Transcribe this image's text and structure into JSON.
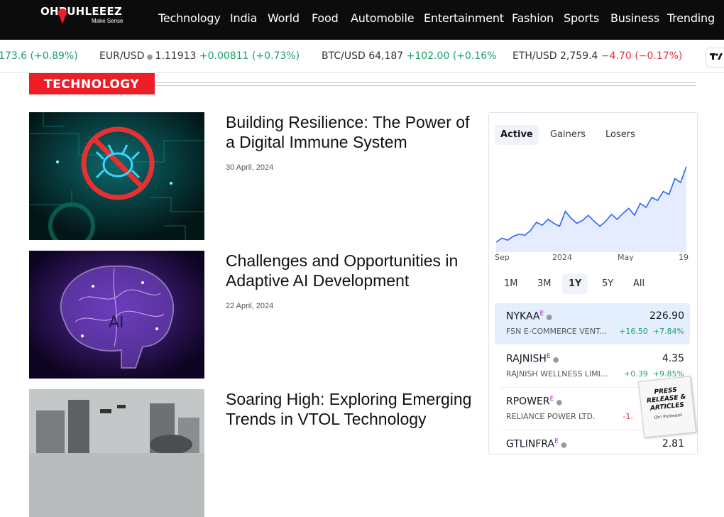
{
  "header": {
    "logo_text": "OHPUHLEEEZ",
    "logo_tagline": "Make Sense",
    "nav": [
      "Technology",
      "India",
      "World",
      "Food",
      "Automobile",
      "Entertainment",
      "Fashion",
      "Sports",
      "Business",
      "Trending"
    ]
  },
  "ticker": [
    {
      "symbol": "",
      "price": "",
      "change": "173.6",
      "pct": "(+0.89%)",
      "dir": "up"
    },
    {
      "symbol": "EUR/USD",
      "price": "1.11913",
      "change": "+0.00811",
      "pct": "(+0.73%)",
      "dir": "up"
    },
    {
      "symbol": "BTC/USD",
      "price": "64,187",
      "change": "+102.00",
      "pct": "(+0.16%",
      "dir": "up"
    },
    {
      "symbol": "ETH/USD",
      "price": "2,759.4",
      "change": "−4.70",
      "pct": "(−0.17%)",
      "dir": "down"
    }
  ],
  "section_title": "TECHNOLOGY",
  "articles": [
    {
      "title": "Building Resilience: The Power of a Digital Immune System",
      "date": "30 April, 2024"
    },
    {
      "title": "Challenges and Opportunities in Adaptive AI Development",
      "date": "22 April, 2024"
    },
    {
      "title": "Soaring High: Exploring Emerging Trends in VTOL Technology",
      "date": ""
    }
  ],
  "widget": {
    "tabs": [
      "Active",
      "Gainers",
      "Losers"
    ],
    "active_tab": "Active",
    "x_labels": [
      "Sep",
      "2024",
      "May",
      "19"
    ],
    "ranges": [
      "1M",
      "3M",
      "1Y",
      "5Y",
      "All"
    ],
    "active_range": "1Y",
    "rows": [
      {
        "symbol": "NYKAA",
        "name": "FSN E-COMMERCE VENT...",
        "price": "226.90",
        "change": "+16.50",
        "pct": "+7.84%",
        "dir": "up"
      },
      {
        "symbol": "RAJNISH",
        "name": "RAJNISH WELLNESS LIMI...",
        "price": "4.35",
        "change": "+0.39",
        "pct": "+9.85%",
        "dir": "up"
      },
      {
        "symbol": "RPOWER",
        "name": "RELIANCE POWER LTD.",
        "price": "",
        "change": "-1.",
        "pct": "",
        "dir": "down"
      },
      {
        "symbol": "GTLINFRA",
        "name": "",
        "price": "2.81",
        "change": "",
        "pct": "",
        "dir": "up"
      }
    ],
    "row_flag": "E",
    "chart_data": {
      "type": "area",
      "title": "",
      "x_ticks": [
        "Sep",
        "2024",
        "May",
        "19"
      ],
      "series": [
        {
          "values": [
            10,
            14,
            12,
            16,
            18,
            17,
            22,
            30,
            27,
            33,
            29,
            26,
            41,
            34,
            29,
            32,
            37,
            31,
            26,
            31,
            38,
            33,
            39,
            44,
            37,
            49,
            45,
            55,
            52,
            61,
            58,
            74,
            70,
            86
          ]
        }
      ]
    }
  },
  "badge": {
    "text": "PRESS RELEASE & ARTICLES",
    "brand": "Oh! Puhleeez"
  }
}
